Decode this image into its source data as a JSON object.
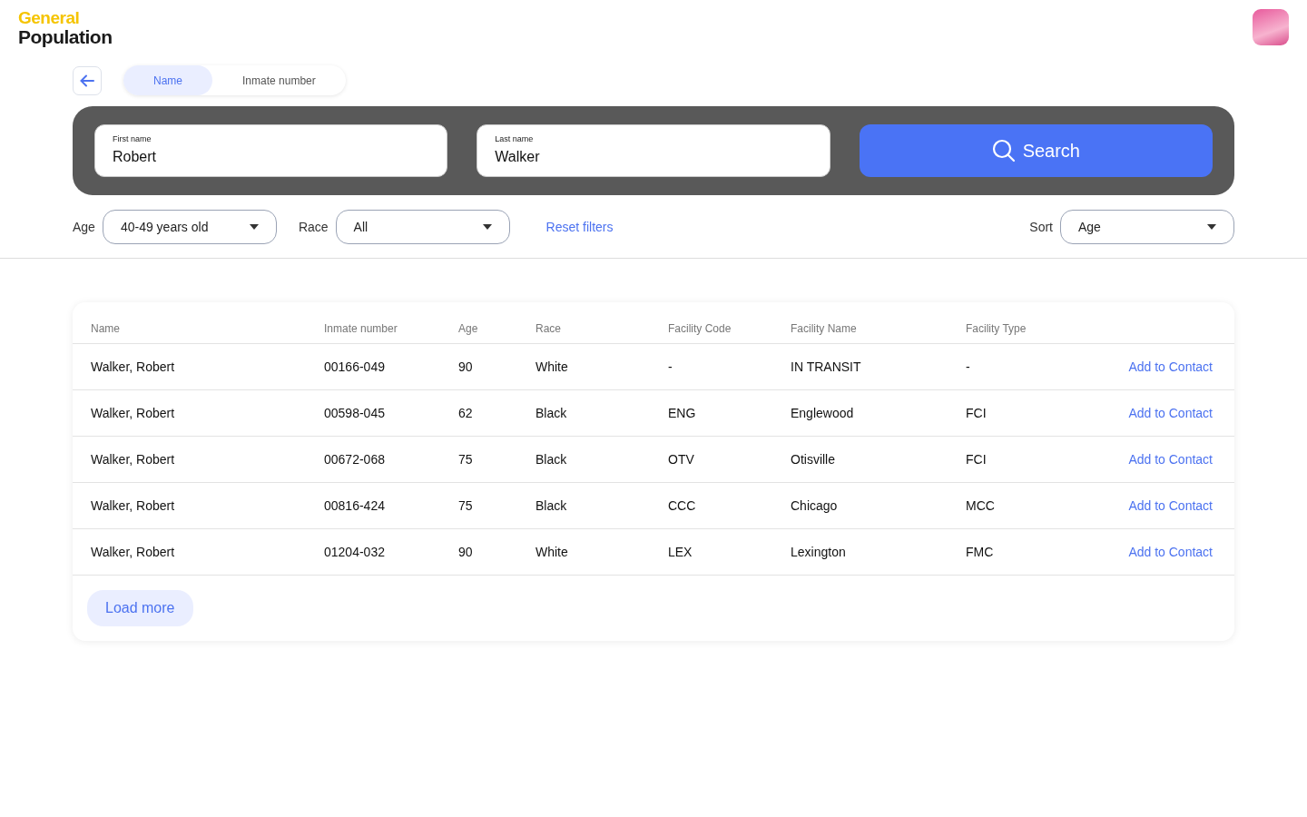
{
  "logo": {
    "line_1": "General",
    "line_2": "Population"
  },
  "search_mode_tabs": [
    {
      "label": "Name",
      "selected": true
    },
    {
      "label": "Inmate number",
      "selected": false
    }
  ],
  "search_panel": {
    "fields": [
      {
        "label": "First name",
        "value": "Robert"
      },
      {
        "label": "Last name",
        "value": "Walker"
      }
    ],
    "button": "Search"
  },
  "filters": [
    {
      "label": "Age",
      "value": "40-49 years old"
    },
    {
      "label": "Race",
      "value": "All"
    }
  ],
  "reset_link": "Reset filters",
  "sort": {
    "label": "Sort",
    "value": "Age"
  },
  "table": {
    "columns": [
      "Name",
      "Inmate number",
      "Age",
      "Race",
      "Facility Code",
      "Facility Name",
      "Facility Type"
    ],
    "rows": [
      {
        "cells": [
          "Walker, Robert",
          "00166-049",
          "90",
          "White",
          "-",
          "IN TRANSIT",
          "-"
        ],
        "action": "Add to Contact"
      },
      {
        "cells": [
          "Walker, Robert",
          "00598-045",
          "62",
          "Black",
          "ENG",
          "Englewood",
          "FCI"
        ],
        "action": "Add to Contact"
      },
      {
        "cells": [
          "Walker, Robert",
          "00672-068",
          "75",
          "Black",
          "OTV",
          "Otisville",
          "FCI"
        ],
        "action": "Add to Contact"
      },
      {
        "cells": [
          "Walker, Robert",
          "00816-424",
          "75",
          "Black",
          "CCC",
          "Chicago",
          "MCC"
        ],
        "action": "Add to Contact"
      },
      {
        "cells": [
          "Walker, Robert",
          "01204-032",
          "90",
          "White",
          "LEX",
          "Lexington",
          "FMC"
        ],
        "action": "Add to Contact"
      }
    ],
    "load_more": "Load more"
  }
}
